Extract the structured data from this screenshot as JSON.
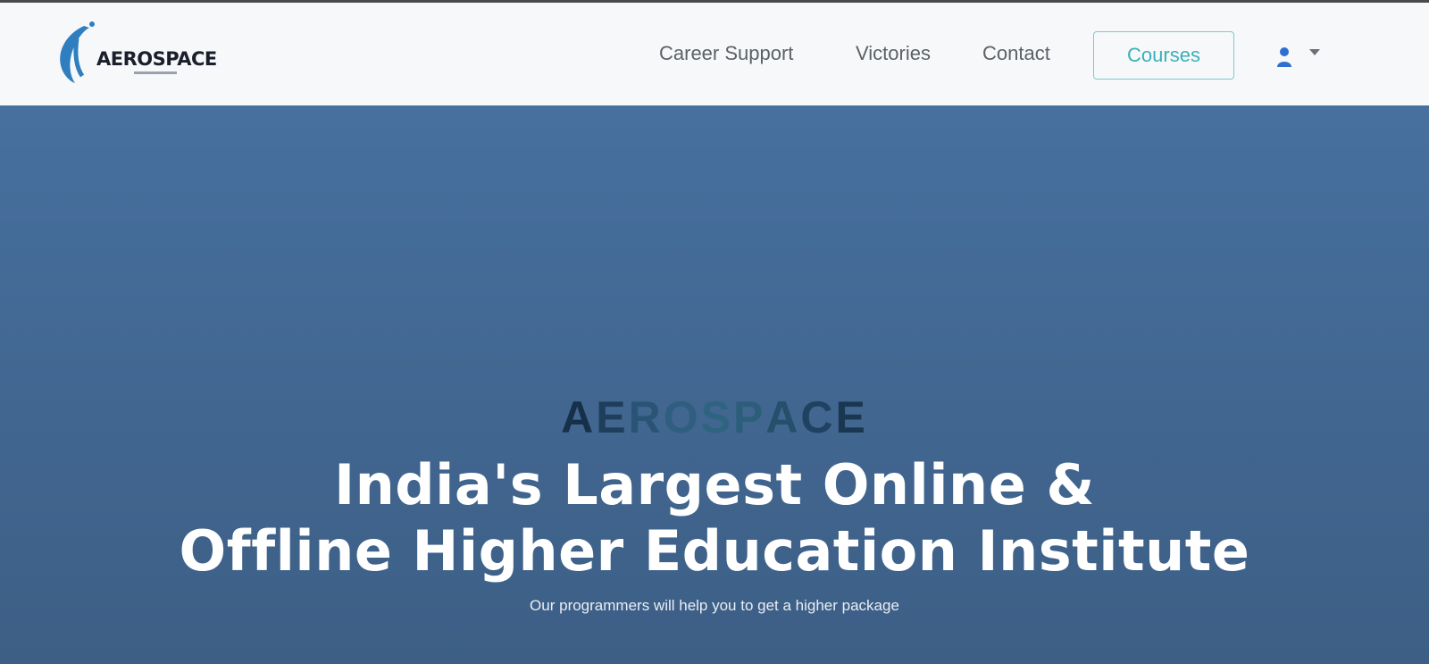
{
  "header": {
    "logo_text": "AEROSPACE",
    "nav": {
      "career_support": "Career Support",
      "victories": "Victories",
      "contact": "Contact",
      "courses": "Courses"
    }
  },
  "hero": {
    "brand_letters": [
      "A",
      "E",
      "R",
      "O",
      "S",
      "P",
      "A",
      "C",
      "E"
    ],
    "brand_colors": [
      "#17304a",
      "#1e3e5c",
      "#2a5476",
      "#2f5e80",
      "#2f6480",
      "#2c5e7a",
      "#264f6c",
      "#1f4260",
      "#1a3752"
    ],
    "title_line1": "India's Largest Online &",
    "title_line2": "Offline Higher Education Institute",
    "subtitle": "Our programmers will help you to get a higher package"
  },
  "colors": {
    "accent": "#3ab0b8",
    "hero_bg": "#416690",
    "nav_bg": "#f7f8fa"
  }
}
